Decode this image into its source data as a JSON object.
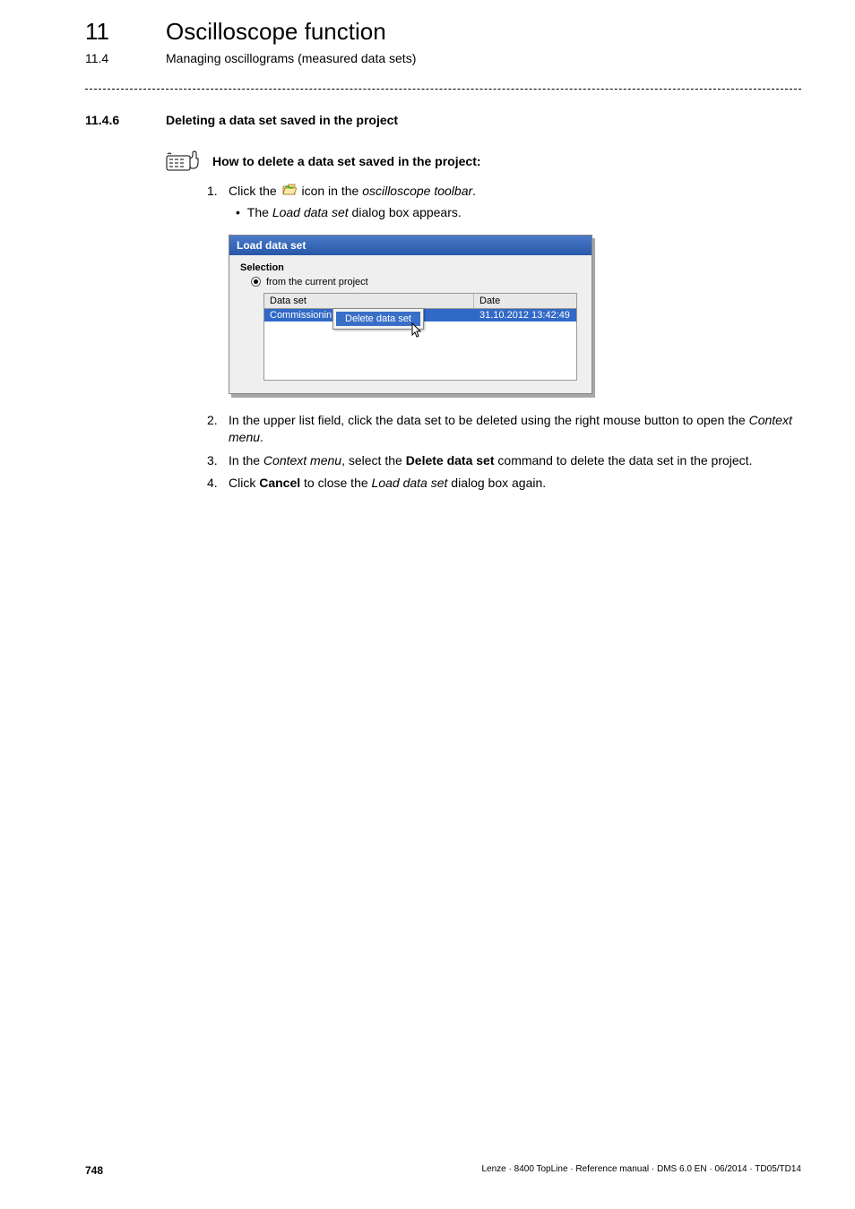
{
  "chapter": {
    "number": "11",
    "title": "Oscilloscope function"
  },
  "section": {
    "number": "11.4",
    "title": "Managing oscillograms (measured data sets)"
  },
  "subsection": {
    "number": "11.4.6",
    "title": "Deleting a data set saved in the project"
  },
  "howto": {
    "text": "How to delete a data set saved in the project:"
  },
  "steps": {
    "s1_prefix": "Click the ",
    "s1_suffix": " icon in the ",
    "s1_em": "oscilloscope toolbar",
    "s1_end": ".",
    "s1_sub_prefix": "The ",
    "s1_sub_em": "Load data set",
    "s1_sub_suffix": " dialog box appears.",
    "s2_prefix": "In the upper list field, click the data set to be deleted using the right mouse button to open the ",
    "s2_em": "Context menu",
    "s2_end": ".",
    "s3_prefix": "In the ",
    "s3_em": "Context menu",
    "s3_mid": ", select the ",
    "s3_strong": "Delete data set",
    "s3_suffix": " command to delete the data set in the project.",
    "s4_prefix": "Click ",
    "s4_strong": "Cancel",
    "s4_mid": " to close the ",
    "s4_em": "Load data set",
    "s4_suffix": " dialog box again."
  },
  "dialog": {
    "title": "Load data set",
    "selection_label": "Selection",
    "radio_label": "from the current project",
    "columns": {
      "dataset": "Data set",
      "date": "Date"
    },
    "rows": [
      {
        "dataset": "Commissionin",
        "date": "31.10.2012 13:42:49"
      }
    ],
    "context_menu_item": "Delete data set"
  },
  "footer": {
    "page": "748",
    "right": "Lenze · 8400 TopLine · Reference manual · DMS 6.0 EN · 06/2014 · TD05/TD14"
  }
}
